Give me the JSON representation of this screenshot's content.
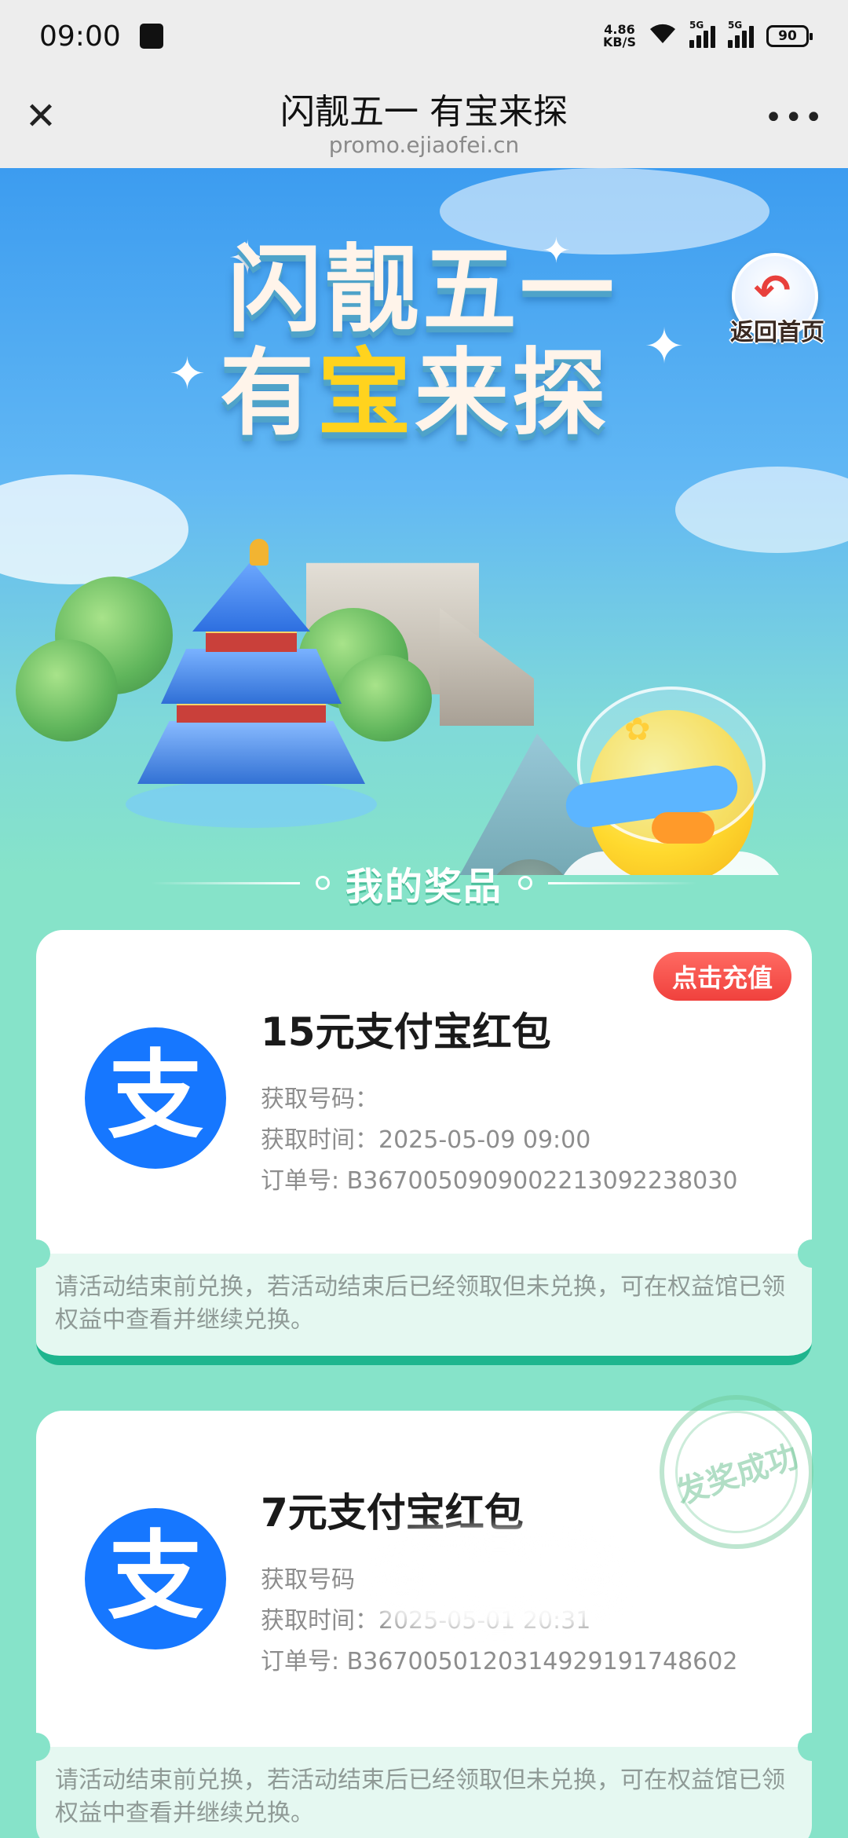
{
  "status_bar": {
    "time": "09:00",
    "net_speed_value": "4.86",
    "net_speed_unit": "KB/S",
    "signal1_tag": "5G",
    "signal2_tag": "5G",
    "battery": "90"
  },
  "nav": {
    "title": "闪靓五一 有宝来探",
    "url": "promo.ejiaofei.cn",
    "close_icon": "close-icon",
    "more_icon": "more-icon"
  },
  "hero": {
    "title_line1": "闪靓五一",
    "title_line2_a": "有",
    "title_line2_gold": "宝",
    "title_line2_b": "来探",
    "back_home_label": "返回首页"
  },
  "section": {
    "title": "我的奖品"
  },
  "prizes": [
    {
      "name": "15元支付宝红包",
      "code_label": "获取号码：",
      "time_label": "获取时间：",
      "time_value": "2025-05-09 09:00",
      "order_label": "订单号: ",
      "order_value": "B3670050909002213092238030",
      "action": "点击充值",
      "note": "请活动结束前兑换，若活动结束后已经领取但未兑换，可在权益馆已领权益中查看并继续兑换。"
    },
    {
      "name": "7元支付宝红包",
      "code_label": "获取号码",
      "time_label": "获取时间：",
      "time_value": "2025-05-01 20:31",
      "order_label": "订单号: ",
      "order_value": "B3670050120314929191748602",
      "stamp": "发奖成功",
      "note": "请活动结束前兑换，若活动结束后已经领取但未兑换，可在权益馆已领权益中查看并继续兑换。"
    }
  ],
  "alipay_glyph": "支",
  "colors": {
    "alipay_blue": "#1677ff",
    "action_red": "#f0413d",
    "card_accent": "#1eb58e",
    "page_bg": "#86e3c9"
  }
}
